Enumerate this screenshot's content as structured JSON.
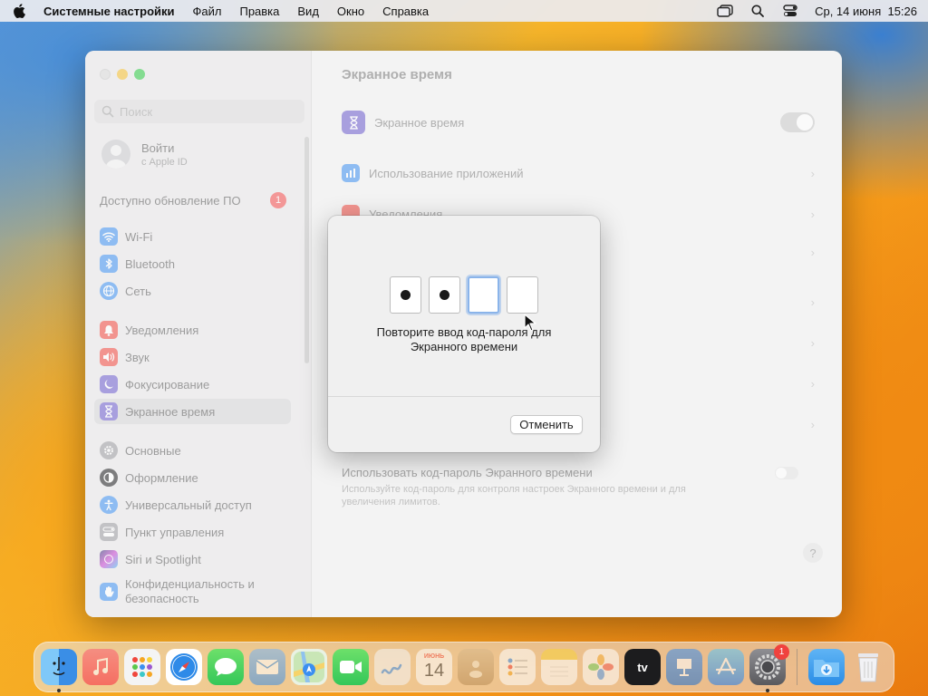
{
  "menubar": {
    "app_name": "Системные настройки",
    "items": [
      "Файл",
      "Правка",
      "Вид",
      "Окно",
      "Справка"
    ],
    "datetime": "Ср, 14 июня  15:26"
  },
  "sidebar": {
    "search_placeholder": "Поиск",
    "account_title": "Войти",
    "account_subtitle": "с Apple ID",
    "update_label": "Доступно обновление ПО",
    "update_badge": "1",
    "items": [
      {
        "label": "Wi-Fi"
      },
      {
        "label": "Bluetooth"
      },
      {
        "label": "Сеть"
      },
      {
        "label": "Уведомления"
      },
      {
        "label": "Звук"
      },
      {
        "label": "Фокусирование"
      },
      {
        "label": "Экранное время"
      },
      {
        "label": "Основные"
      },
      {
        "label": "Оформление"
      },
      {
        "label": "Универсальный доступ"
      },
      {
        "label": "Пункт управления"
      },
      {
        "label": "Siri и Spotlight"
      },
      {
        "label": "Конфиденциальность и безопасность"
      }
    ]
  },
  "main": {
    "title": "Экранное время",
    "screen_time_label": "Экранное время",
    "rows": [
      {
        "label": "Использование приложений"
      },
      {
        "label": "Уведомления"
      }
    ],
    "passcode_title": "Использовать код-пароль Экранного времени",
    "passcode_desc": "Используйте код-пароль для контроля настроек Экранного времени и для увеличения лимитов."
  },
  "dialog": {
    "prompt": "Повторите ввод код-пароля для Экранного времени",
    "cancel_label": "Отменить",
    "digits_entered": 2,
    "digits_total": 4
  },
  "dock": {
    "calendar_day": "14",
    "calendar_month": "ИЮНЬ",
    "tv_label": "tv",
    "settings_badge": "1"
  },
  "colors": {
    "accent": "#8ab4ea",
    "badge": "#f24b4b"
  }
}
